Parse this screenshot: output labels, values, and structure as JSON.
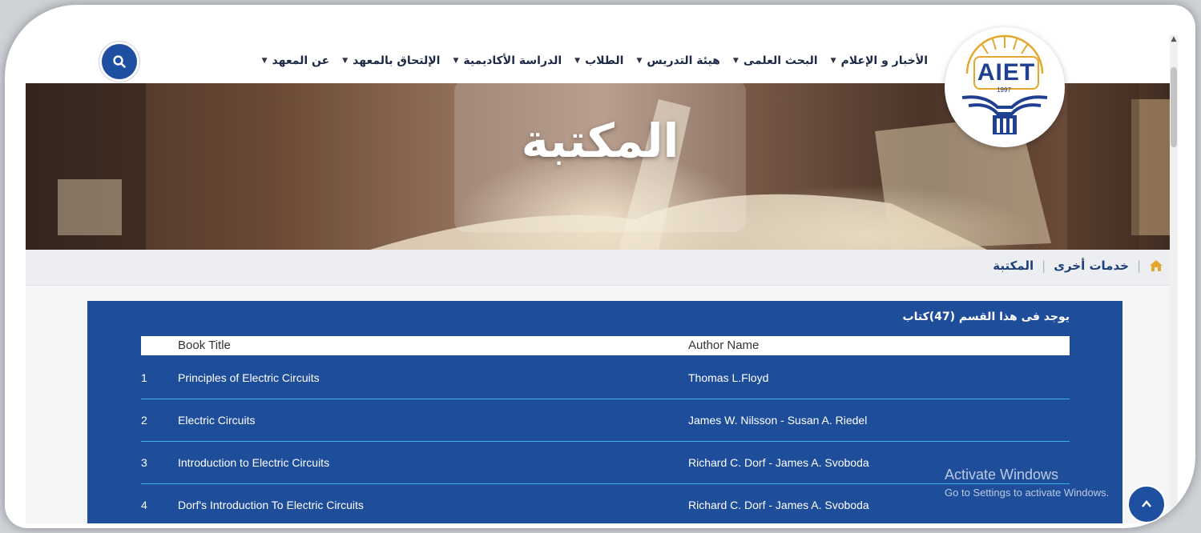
{
  "nav": {
    "items": [
      {
        "label": "عن المعهد"
      },
      {
        "label": "الإلتحاق بالمعهد"
      },
      {
        "label": "الدراسة الأكاديمية"
      },
      {
        "label": "الطلاب"
      },
      {
        "label": "هيئة التدريس"
      },
      {
        "label": "البحث العلمى"
      },
      {
        "label": "الأخبار و الإعلام"
      }
    ],
    "caret": "▼"
  },
  "logo": {
    "text": "AIET",
    "year": "1997"
  },
  "banner": {
    "title": "المكتبة"
  },
  "breadcrumb": {
    "home_icon": "home-icon",
    "items": [
      "خدمات أخرى",
      "المكتبة"
    ],
    "separator": "|"
  },
  "books": {
    "count_text": "يوجد فى هذا القسم (47)كتاب",
    "headers": {
      "title": "Book Title",
      "author": "Author Name"
    },
    "rows": [
      {
        "num": "1",
        "title": "Principles of Electric Circuits",
        "author": "Thomas L.Floyd"
      },
      {
        "num": "2",
        "title": "Electric Circuits",
        "author": "James W. Nilsson - Susan A. Riedel"
      },
      {
        "num": "3",
        "title": "Introduction to Electric Circuits",
        "author": "Richard C. Dorf - James A. Svoboda"
      },
      {
        "num": "4",
        "title": "Dorf's Introduction To Electric Circuits",
        "author": "Richard C. Dorf - James A. Svoboda"
      }
    ]
  },
  "watermark": {
    "line1": "Activate Windows",
    "line2": "Go to Settings to activate Windows."
  },
  "colors": {
    "primary": "#1e4d9a",
    "row_divider": "#3fb3e6",
    "logo_gold": "#e3a82b"
  }
}
